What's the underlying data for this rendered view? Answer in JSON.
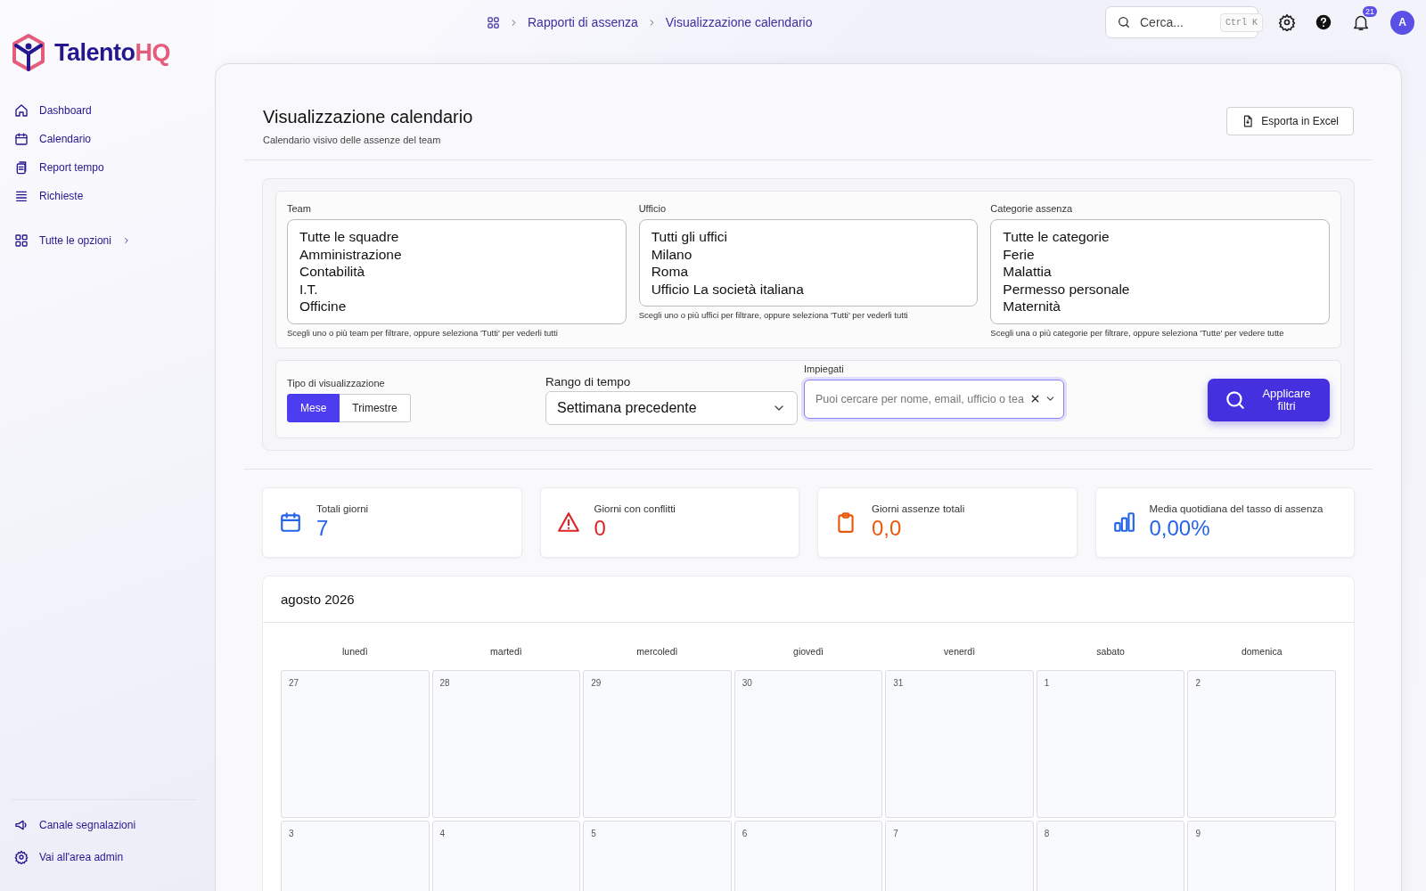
{
  "breadcrumb": [
    "Rapporti di assenza",
    "Visualizzazione calendario"
  ],
  "topbar": {
    "search_placeholder": "Cerca...",
    "shortcut": "Ctrl K",
    "notifications": "21",
    "avatar": "A"
  },
  "sidebar": {
    "logo": {
      "brand": "Talento",
      "accent": "HQ"
    },
    "items": [
      {
        "label": "Dashboard",
        "kind": "home"
      },
      {
        "label": "Calendario",
        "kind": "calendar"
      },
      {
        "label": "Report tempo",
        "kind": "report"
      },
      {
        "label": "Richieste",
        "kind": "list"
      }
    ],
    "more": "Tutte le opzioni",
    "footer": [
      {
        "label": "Canale segnalazioni",
        "kind": "megaphone"
      },
      {
        "label": "Vai all'area admin",
        "kind": "gear"
      }
    ]
  },
  "page": {
    "title": "Visualizzazione calendario",
    "subtitle": "Calendario visivo delle assenze del team",
    "export_button": "Esporta in Excel"
  },
  "filters": [
    {
      "label": "Team",
      "options": [
        "Tutte le squadre",
        "Amministrazione",
        "Contabilità",
        "I.T.",
        "Officine"
      ],
      "hint": "Scegli uno o più team per filtrare, oppure seleziona 'Tutti' per vederli tutti"
    },
    {
      "label": "Ufficio",
      "options": [
        "Tutti gli uffici",
        "Milano",
        "Roma",
        "Ufficio La società italiana"
      ],
      "hint": "Scegli uno o più uffici per filtrare, oppure seleziona 'Tutti' per vederli tutti"
    },
    {
      "label": "Categorie assenza",
      "options": [
        "Tutte le categorie",
        "Ferie",
        "Malattia",
        "Permesso personale",
        "Maternità"
      ],
      "hint": "Scegli una o più categorie per filtrare, oppure seleziona 'Tutte' per vedere tutte"
    }
  ],
  "view_type": {
    "label": "Tipo di visualizzazione",
    "options": [
      {
        "label": "Mese",
        "selected": true
      },
      {
        "label": "Trimestre",
        "selected": false
      }
    ]
  },
  "time_range": {
    "label": "Rango di tempo",
    "value": "Settimana precedente"
  },
  "employees": {
    "label": "Impiegati",
    "placeholder": "Puoi cercare per nome, email, ufficio o tea"
  },
  "apply_button": "Applicare filtri",
  "stats": [
    {
      "label": "Totali giorni",
      "value": "7",
      "kind": "calendar",
      "color": "#2563eb"
    },
    {
      "label": "Giorni con conflitti",
      "value": "0",
      "kind": "warning",
      "color": "#dc2626"
    },
    {
      "label": "Giorni assenze totali",
      "value": "0,0",
      "kind": "clipboard",
      "color": "#ea580c"
    },
    {
      "label": "Media quotidiana del tasso di assenza",
      "value": "0,00%",
      "kind": "chart",
      "color": "#2563eb"
    }
  ],
  "calendar": {
    "title": "agosto 2026",
    "weekdays": [
      "lunedì",
      "martedì",
      "mercoledì",
      "giovedì",
      "venerdì",
      "sabato",
      "domenica"
    ],
    "weeks": [
      [
        "27",
        "28",
        "29",
        "30",
        "31",
        "1",
        "2"
      ],
      [
        "3",
        "4",
        "5",
        "6",
        "7",
        "8",
        "9"
      ]
    ]
  }
}
